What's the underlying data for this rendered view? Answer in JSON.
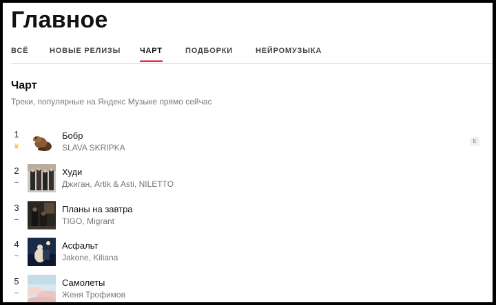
{
  "page": {
    "title": "Главное"
  },
  "tabs": [
    {
      "label": "ВСЁ"
    },
    {
      "label": "НОВЫЕ РЕЛИЗЫ"
    },
    {
      "label": "ЧАРТ",
      "active": true
    },
    {
      "label": "ПОДБОРКИ"
    },
    {
      "label": "НЕЙРОМУЗЫКА"
    }
  ],
  "chart": {
    "title": "Чарт",
    "subtitle": "Треки, популярные на Яндекс Музыке прямо сейчас",
    "tracks": [
      {
        "rank": "1",
        "trend": "♛",
        "title": "Бобр",
        "artist": "SLAVA SKRIPKA",
        "explicit": "E",
        "cover_icon": "beaver-icon"
      },
      {
        "rank": "2",
        "trend": "–",
        "title": "Худи",
        "artist": "Джиган, Artik & Asti, NILETTO",
        "cover_icon": "group-photo-icon"
      },
      {
        "rank": "3",
        "trend": "–",
        "title": "Планы на завтра",
        "artist": "TIGO, Migrant",
        "cover_icon": "dark-photo-icon"
      },
      {
        "rank": "4",
        "trend": "–",
        "title": "Асфальт",
        "artist": "Jakone, Kiliana",
        "cover_icon": "night-photo-icon"
      },
      {
        "rank": "5",
        "trend": "–",
        "title": "Самолеты",
        "artist": "Женя Трофимов",
        "cover_icon": "sky-photo-icon"
      }
    ]
  },
  "colors": {
    "accent": "#e8252b",
    "crown": "#f2b300",
    "text": "#111111",
    "muted": "#777777"
  }
}
